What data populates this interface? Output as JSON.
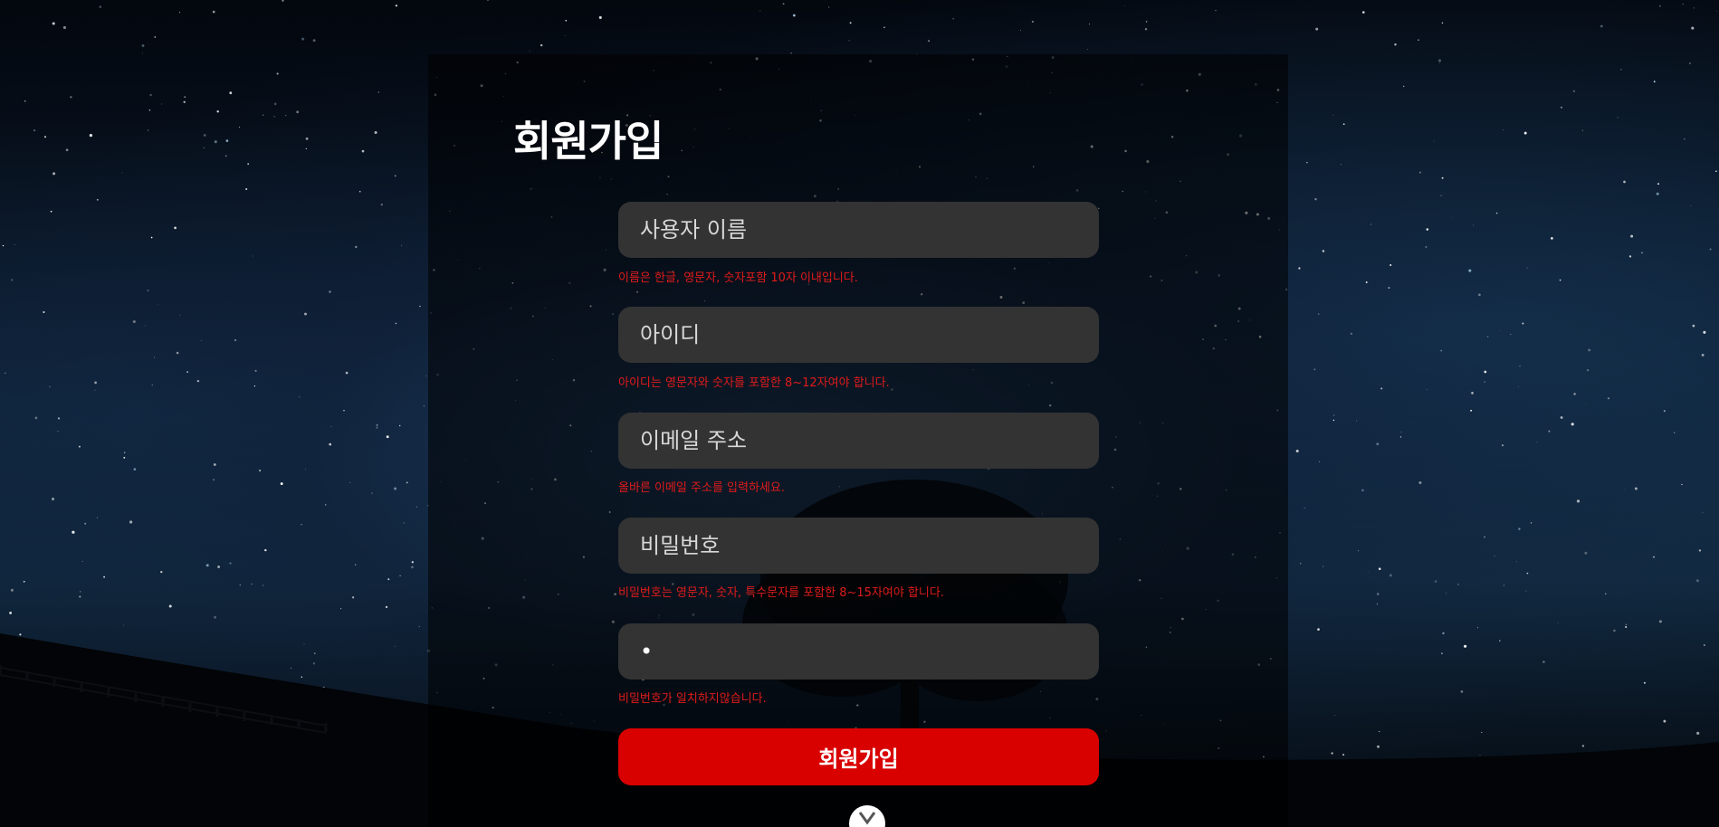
{
  "page": {
    "title": "회원가입"
  },
  "form": {
    "username": {
      "placeholder": "사용자 이름",
      "value": "",
      "hint": "이름은 한글, 영문자, 숫자포함 10자 이내입니다."
    },
    "userid": {
      "placeholder": "아이디",
      "value": "",
      "hint": "아이디는 영문자와 숫자를 포함한 8~12자여야 합니다."
    },
    "email": {
      "placeholder": "이메일 주소",
      "value": "",
      "hint": "올바른 이메일 주소를 입력하세요."
    },
    "password": {
      "placeholder": "비밀번호",
      "value": "",
      "hint": "비밀번호는 영문자, 숫자, 특수문자를 포함한 8~15자여야 합니다."
    },
    "password_confirm": {
      "placeholder": "",
      "value": "x",
      "hint": "비밀번호가 일치하지않습니다."
    },
    "submit_label": "회원가입"
  },
  "scroll_button": {
    "icon": "chevron-down-icon"
  },
  "colors": {
    "accent": "#d90000",
    "error_text": "#e01b1b",
    "input_bg": "#333333",
    "title_text": "#ffffff"
  }
}
